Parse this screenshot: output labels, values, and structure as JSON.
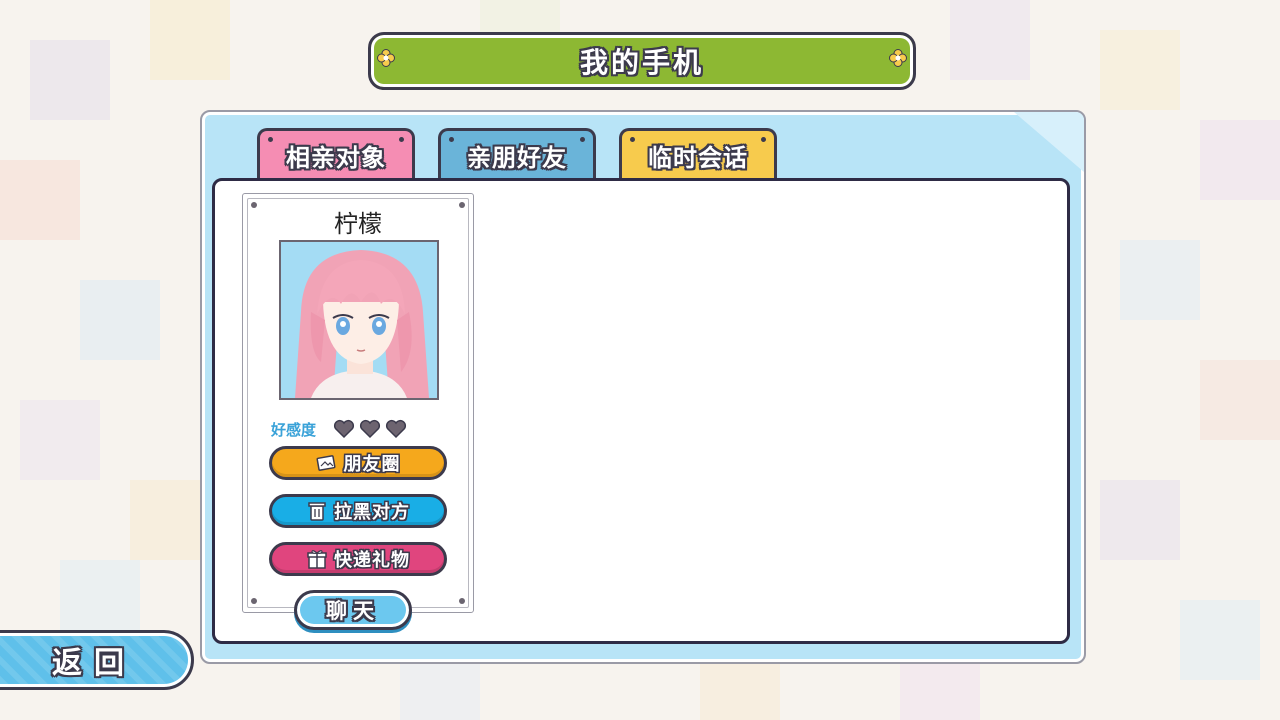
{
  "screen": {
    "title": "我的手机"
  },
  "tabs": [
    {
      "label": "相亲对象",
      "color": "#f58db3",
      "selected": true
    },
    {
      "label": "亲朋好友",
      "color": "#6ab4d9",
      "selected": false
    },
    {
      "label": "临时会话",
      "color": "#f7cb4d",
      "selected": false
    }
  ],
  "contact": {
    "name": "柠檬",
    "favor_label": "好感度",
    "hearts_total": 3,
    "hearts_filled": 0,
    "actions": {
      "moments": {
        "label": "朋友圈",
        "icon": "photo-icon",
        "color": "#f5a81c"
      },
      "block": {
        "label": "拉黑对方",
        "icon": "trash-icon",
        "color": "#19aee6"
      },
      "gift": {
        "label": "快递礼物",
        "icon": "gift-icon",
        "color": "#e0457e"
      }
    },
    "chat_label": "聊天"
  },
  "back_label": "返回",
  "colors": {
    "panel": "#b8e4f7",
    "title_banner": "#8db833",
    "outline": "#3c3a4c",
    "favor_text": "#3aa2d8"
  }
}
